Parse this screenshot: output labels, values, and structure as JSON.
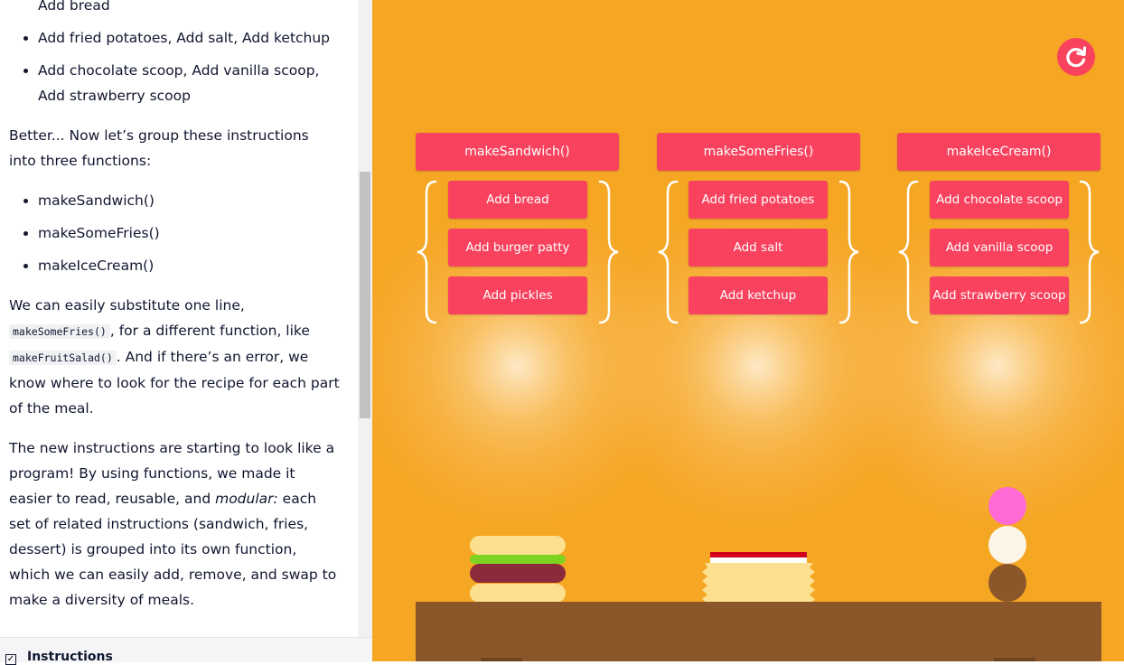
{
  "lesson": {
    "list1_tail": "Add bread",
    "list1": [
      "Add fried potatoes, Add salt, Add ketchup",
      "Add chocolate scoop, Add vanilla scoop, Add strawberry scoop"
    ],
    "para1": "Better... Now let’s group these instructions into three functions:",
    "list2": [
      "makeSandwich()",
      "makeSomeFries()",
      "makeIceCream()"
    ],
    "para2": {
      "t1": "We can easily substitute one line, ",
      "code1": "makeSomeFries()",
      "t2": ", for a different function, like ",
      "code2": "makeFruitSalad()",
      "t3": ". And if there’s an error, we know where to look for the recipe for each part of the meal."
    },
    "para3": {
      "t1": "The new instructions are starting to look like a program! By using functions, we made it easier to read, reusable, and ",
      "em": "modular:",
      "t2": " each set of related instructions (sandwich, fries, dessert) is grouped into its own function, which we can easily add, remove, and swap to make a diversity of meals."
    }
  },
  "bottom_bar": {
    "checkbox_mark": "✓",
    "label": "Instructions"
  },
  "stage": {
    "reset_icon": "refresh-icon",
    "functions": [
      {
        "name": "makeSandwich()",
        "steps": [
          "Add bread",
          "Add burger patty",
          "Add pickles"
        ]
      },
      {
        "name": "makeSomeFries()",
        "steps": [
          "Add fried potatoes",
          "Add salt",
          "Add ketchup"
        ]
      },
      {
        "name": "makeIceCream()",
        "steps": [
          "Add chocolate scoop",
          "Add vanilla scoop",
          "Add strawberry scoop"
        ]
      }
    ]
  },
  "colors": {
    "stage_bg": "#f5a623",
    "accent": "#f8425e",
    "table": "#8b572a",
    "bun": "#fde08f",
    "lettuce": "#7ed321",
    "patty": "#8b2a3a",
    "ketchup": "#d0021b",
    "strawberry": "#ff6ad5",
    "vanilla": "#fdf5e6",
    "chocolate": "#8b572a"
  }
}
